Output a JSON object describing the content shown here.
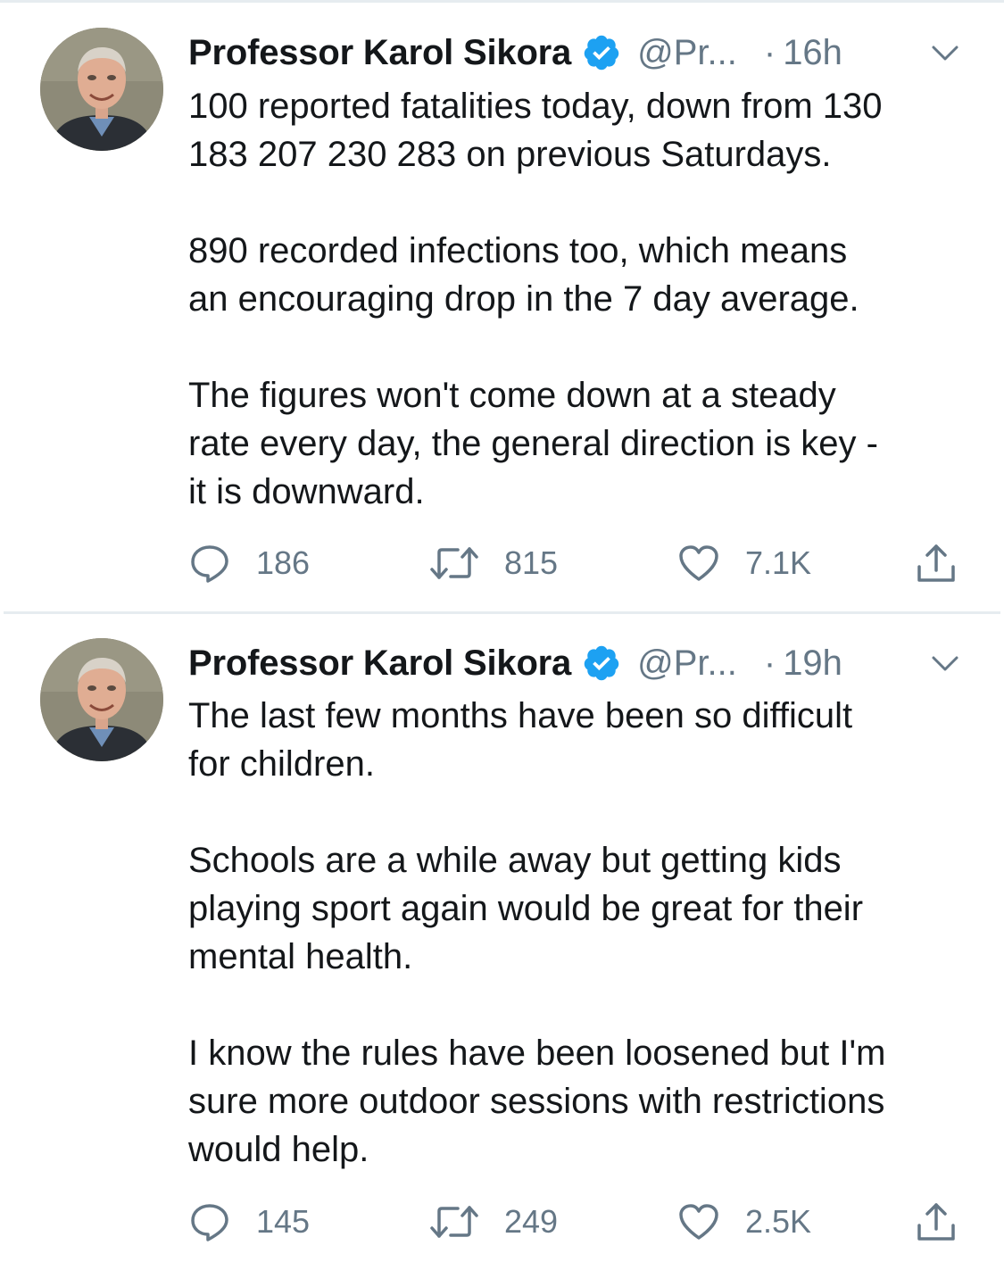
{
  "colors": {
    "text_primary": "#14171a",
    "text_secondary": "#657786",
    "verified_blue": "#1da1f2",
    "divider": "#e6ecf0"
  },
  "tweets": [
    {
      "display_name": "Professor Karol Sikora",
      "verified_icon": "verified-badge-icon",
      "handle": "@Pr...",
      "separator": "·",
      "time": "16h",
      "paragraphs": [
        "100 reported fatalities today, down from 130\n183 207 230 283 on previous Saturdays.",
        "890 recorded infections too, which means\nan encouraging drop in the 7 day average.",
        "The figures won't come down at a steady\nrate every day, the general direction is key -\nit is downward."
      ],
      "replies": "186",
      "retweets": "815",
      "likes": "7.1K"
    },
    {
      "display_name": "Professor Karol Sikora",
      "verified_icon": "verified-badge-icon",
      "handle": "@Pr...",
      "separator": "·",
      "time": "19h",
      "paragraphs": [
        "The last few months have been so difficult\nfor children.",
        "Schools are a while away but getting kids\nplaying sport again would be great for their\nmental health.",
        "I know the rules have been loosened but I'm\nsure more outdoor sessions with restrictions\nwould help."
      ],
      "replies": "145",
      "retweets": "249",
      "likes": "2.5K"
    }
  ],
  "icons": {
    "reply": "reply-icon",
    "retweet": "retweet-icon",
    "like": "like-icon",
    "share": "share-icon",
    "more": "chevron-down-icon"
  }
}
